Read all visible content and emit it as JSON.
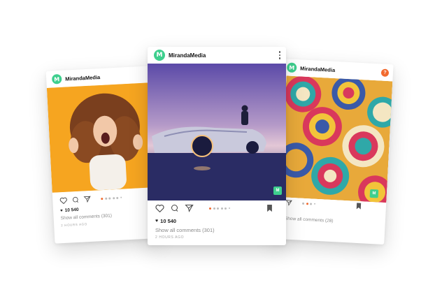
{
  "brand": {
    "name": "MirandaMedia",
    "logo_letter": "M",
    "accent": "#3ecf8e",
    "highlight": "#f26a2e"
  },
  "cards": {
    "left": {
      "likes": "10 540",
      "comments": "Show all comments (301)",
      "time": "2 HOURS AGO",
      "photo": "woman-excited-orange-background"
    },
    "center": {
      "likes": "10 540",
      "comments": "Show all comments (301)",
      "time": "2 HOURS AGO",
      "photo": "sports-car-purple-sunset"
    },
    "right": {
      "comments": "Show all comments (28)",
      "badge": "?",
      "photo": "colorful-swirl-pattern"
    }
  },
  "icons": [
    "heart-icon",
    "comment-icon",
    "send-icon",
    "bookmark-icon",
    "more-icon"
  ]
}
